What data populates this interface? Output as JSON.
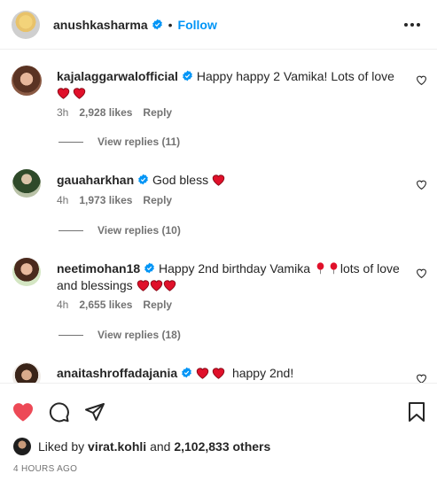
{
  "header": {
    "username": "anushkasharma",
    "separator": "•",
    "follow_label": "Follow",
    "more_icon": "more-horizontal-icon"
  },
  "comments": [
    {
      "username": "kajalaggarwalofficial",
      "text": "Happy happy 2 Vamika! Lots of love",
      "time": "3h",
      "likes": "2,928 likes",
      "reply_label": "Reply",
      "view_replies": "View replies (11)"
    },
    {
      "username": "gauaharkhan",
      "text": "God bless",
      "time": "4h",
      "likes": "1,973 likes",
      "reply_label": "Reply",
      "view_replies": "View replies (10)"
    },
    {
      "username": "neetimohan18",
      "text_a": "Happy 2nd birthday Vamika",
      "text_b": "lots of love and blessings",
      "time": "4h",
      "likes": "2,655 likes",
      "reply_label": "Reply",
      "view_replies": "View replies (18)"
    },
    {
      "username": "anaitashroffadajania",
      "text": "happy 2nd!"
    }
  ],
  "actions": {
    "icons": [
      "heart-filled-icon",
      "comment-icon",
      "share-icon",
      "bookmark-icon"
    ],
    "liked_by_prefix": "Liked by",
    "liked_by_user": "virat.kohli",
    "liked_by_mid": "and",
    "liked_by_count": "2,102,833 others",
    "timestamp": "4 HOURS AGO"
  },
  "colors": {
    "accent": "#0095f6",
    "heart": "#ed4956",
    "secondary_text": "#737373",
    "verified": "#0095f6"
  }
}
